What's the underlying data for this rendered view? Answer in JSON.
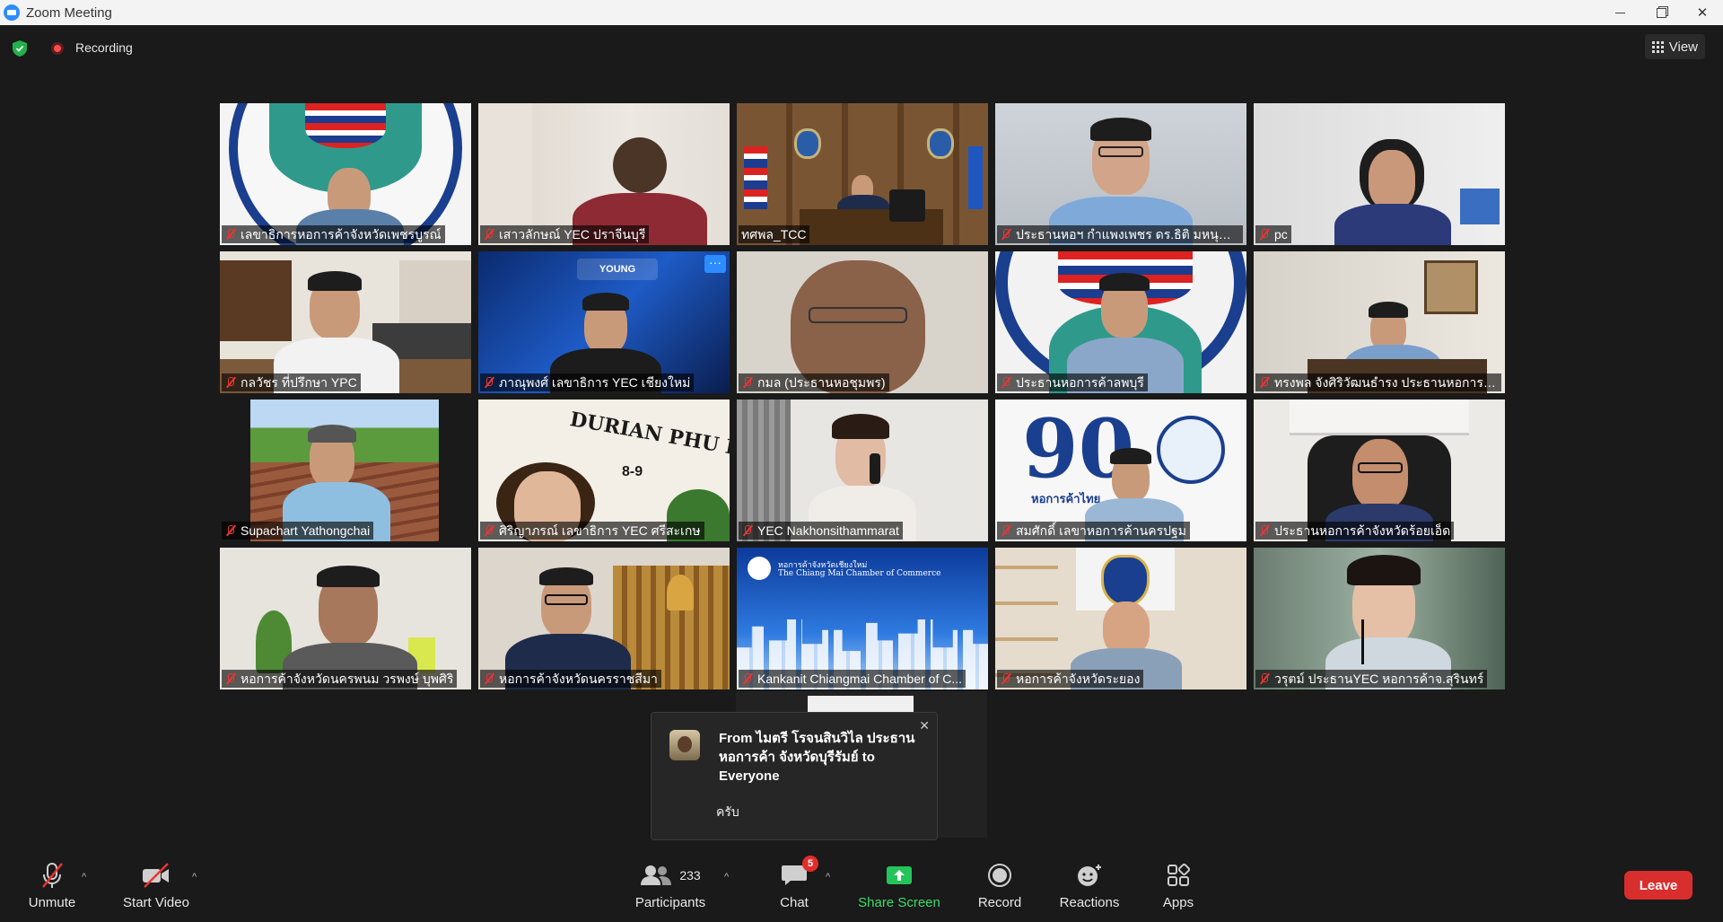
{
  "window": {
    "title": "Zoom Meeting"
  },
  "topbar": {
    "recording_label": "Recording",
    "view_label": "View"
  },
  "participants": [
    {
      "name": "เลขาธิการหอการค้าจังหวัดเพชรบูรณ์",
      "muted": true,
      "active": false
    },
    {
      "name": "เสาวลักษณ์ YEC ปราจีนบุรี",
      "muted": true,
      "active": false
    },
    {
      "name": "ทศพล_TCC",
      "muted": false,
      "active": true
    },
    {
      "name": "ประธานหอฯ กำแพงเพชร ดร.ธิติ มหนุญ...",
      "muted": true,
      "active": false
    },
    {
      "name": "pc",
      "muted": true,
      "active": false
    },
    {
      "name": "กลวัชร ที่ปรึกษา YPC",
      "muted": true,
      "active": false
    },
    {
      "name": "ภาณุพงศ์ เลขาธิการ YEC เชียงใหม่",
      "muted": true,
      "active": false
    },
    {
      "name": "กมล (ประธานหอชุมพร)",
      "muted": true,
      "active": false
    },
    {
      "name": "ประธานหอการค้าลพบุรี",
      "muted": true,
      "active": false
    },
    {
      "name": "ทรงพล จังศิริวัฒนธำรง ประธานหอการค้...",
      "muted": true,
      "active": false
    },
    {
      "name": "Supachart Yathongchai",
      "muted": true,
      "active": false
    },
    {
      "name": "ศิริญาภรณ์ เลขาธิการ YEC ศรีสะเกษ",
      "muted": true,
      "active": false
    },
    {
      "name": "YEC Nakhonsithammarat",
      "muted": true,
      "active": false
    },
    {
      "name": "สมศักดิ์ เลขาหอการค้านครปฐม",
      "muted": true,
      "active": false
    },
    {
      "name": "ประธานหอการค้าจังหวัดร้อยเอ็ด",
      "muted": true,
      "active": false
    },
    {
      "name": "หอการค้าจังหวัดนครพนม วรพงษ์ บุพศิริ",
      "muted": true,
      "active": false
    },
    {
      "name": "หอการค้าจังหวัดนครราชสีมา",
      "muted": true,
      "active": false
    },
    {
      "name": "Kankanit Chiangmai Chamber of C...",
      "muted": true,
      "active": false
    },
    {
      "name": "หอการค้าจังหวัดระยอง",
      "muted": true,
      "active": false
    },
    {
      "name": "วรุตม์ ประธานYEC หอการค้าจ.สุรินทร์",
      "muted": true,
      "active": false
    }
  ],
  "tile_text": {
    "durian_banner": "DURIAN PHU KHAO FAI",
    "durian_date": "8-9",
    "young_logo": "YOUNG",
    "chiangmai_thai": "หอการค้าจังหวัดเชียงใหม่",
    "chiangmai_en": "The Chiang Mai Chamber of Commerce",
    "tcc90_sub": "หอการค้าไทย"
  },
  "chat_notification": {
    "from": "From ไมตรี โรจนสินวิไล ประธานหอการค้า จังหวัดบุรีรัมย์ to Everyone",
    "message": "ครับ"
  },
  "toolbar": {
    "unmute": "Unmute",
    "start_video": "Start Video",
    "participants": "Participants",
    "participants_count": "233",
    "chat": "Chat",
    "chat_badge": "5",
    "share_screen": "Share Screen",
    "record": "Record",
    "reactions": "Reactions",
    "apps": "Apps",
    "leave": "Leave"
  },
  "colors": {
    "share_green": "#3fdc6b",
    "leave_red": "#d92e2e",
    "active_speaker": "#e5e86a",
    "zoom_blue": "#2d8cff"
  }
}
